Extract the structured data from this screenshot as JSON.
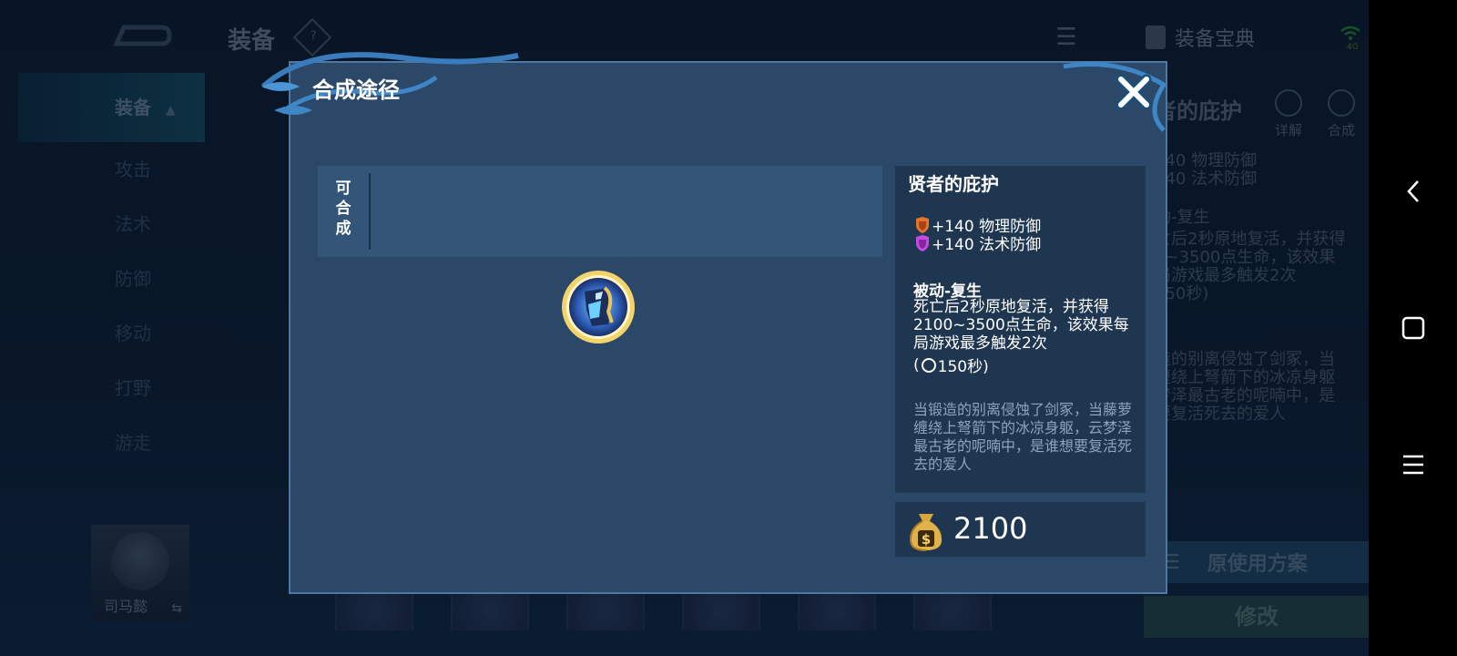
{
  "header": {
    "title": "装备",
    "help": "?",
    "codex_label": "装备宝典"
  },
  "sidebar": {
    "items": [
      {
        "label": "装备",
        "active": true
      },
      {
        "label": "攻击"
      },
      {
        "label": "法术"
      },
      {
        "label": "防御"
      },
      {
        "label": "移动"
      },
      {
        "label": "打野"
      },
      {
        "label": "游走"
      }
    ]
  },
  "hero": {
    "name": "司马懿",
    "swap": "⇆"
  },
  "background_panel": {
    "item_title": "者的庇护",
    "detail": "详解",
    "craft": "合成",
    "stat1": "140 物理防御",
    "stat2": "140 法术防御",
    "passive": "动-复生",
    "desc1": "亡后2秒原地复活，并获得",
    "desc2": "0~3500点生命，该效果",
    "desc3": "局游戏最多触发2次",
    "desc4": "150秒)",
    "lore1": "造的别离侵蚀了剑冢，当",
    "lore2": "缠绕上弩箭下的冰凉身躯",
    "lore3": "梦泽最古老的呢喃中，是",
    "lore4": "要复活死去的爱人",
    "plan_button": "原使用方案",
    "modify_button": "修改"
  },
  "modal": {
    "title": "合成途径",
    "craft_label": "可合成",
    "item_name": "贤者的庇护",
    "stats": [
      {
        "text": "+140 物理防御",
        "color": "#e8732c"
      },
      {
        "text": "+140 法术防御",
        "color": "#c64be0"
      }
    ],
    "passive_title": "被动-复生",
    "passive_desc": "死亡后2秒原地复活，并获得2100~3500点生命，该效果每局游戏最多触发2次",
    "cooldown_prefix": "(",
    "cooldown": "150秒)",
    "lore": "当锻造的别离侵蚀了剑冢，当藤萝缠绕上弩箭下的冰凉身躯，云梦泽最古老的呢喃中，是谁想要复活死去的爱人",
    "price": "2100"
  },
  "colors": {
    "modal_bg": "#2b4868",
    "card_bg": "#1f3650",
    "accent_gold": "#e8c65a"
  }
}
